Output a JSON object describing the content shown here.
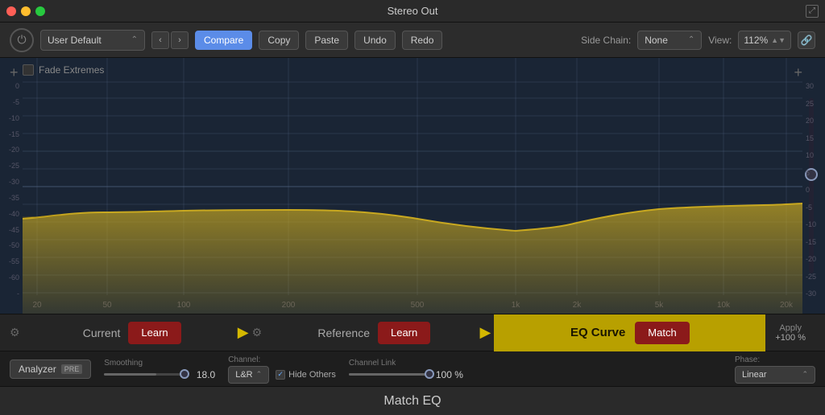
{
  "titleBar": {
    "title": "Stereo Out"
  },
  "toolbar": {
    "preset": "User Default",
    "compare_label": "Compare",
    "copy_label": "Copy",
    "paste_label": "Paste",
    "undo_label": "Undo",
    "redo_label": "Redo",
    "sidechain_label": "Side Chain:",
    "sidechain_value": "None",
    "view_label": "View:",
    "view_value": "112%",
    "link_icon": "🔗"
  },
  "eq": {
    "fade_extremes_label": "Fade Extremes",
    "add_icon": "+",
    "y_left": [
      "0",
      "-5",
      "-10",
      "-15",
      "-20",
      "-25",
      "-30",
      "-35",
      "-40",
      "-45",
      "-50",
      "-55",
      "-60",
      "-"
    ],
    "y_right": [
      "30",
      "25",
      "20",
      "15",
      "10",
      "5",
      "0",
      "-5",
      "-10",
      "-15",
      "-20",
      "-25",
      "-30"
    ],
    "x_labels": [
      "20",
      "50",
      "100",
      "200",
      "500",
      "1k",
      "2k",
      "5k",
      "10k",
      "20k"
    ]
  },
  "matchBar": {
    "current_label": "Current",
    "learn_label": "Learn",
    "reference_label": "Reference",
    "reference_learn_label": "Learn",
    "eq_curve_label": "EQ Curve",
    "match_label": "Match",
    "apply_label": "Apply",
    "apply_value": "+100 %"
  },
  "paramsBar": {
    "analyzer_label": "Analyzer",
    "pre_label": "PRE",
    "smoothing_label": "Smoothing",
    "smoothing_value": "18.0",
    "channel_label": "Channel:",
    "channel_value": "L&R",
    "hide_others_label": "Hide Others",
    "channel_link_label": "Channel Link",
    "channel_link_value": "100 %",
    "phase_label": "Phase:",
    "phase_value": "Linear"
  },
  "pluginTitle": "Match EQ"
}
